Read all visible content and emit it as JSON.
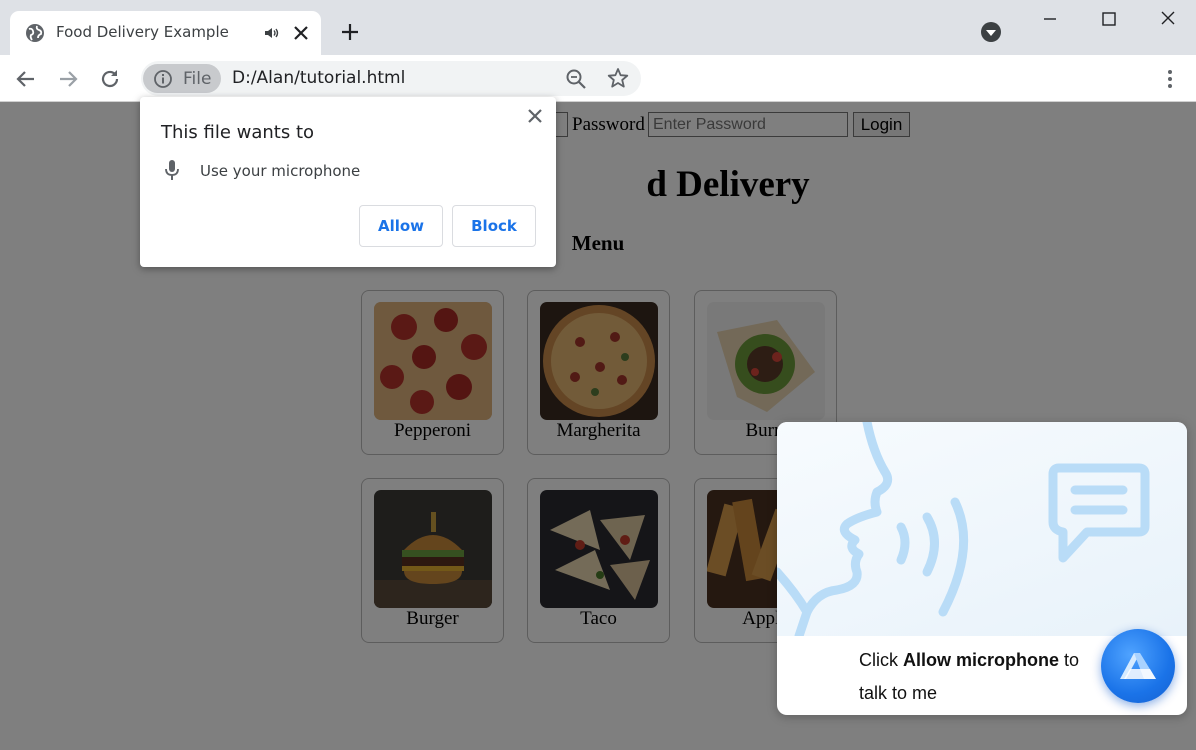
{
  "browser": {
    "tab_title": "Food Delivery Example",
    "site_chip_label": "File",
    "url": "D:/Alan/tutorial.html"
  },
  "page": {
    "password_label": "Password",
    "password_placeholder": "Enter Password",
    "login_label": "Login",
    "site_title": "d Delivery",
    "menu_heading": "Menu",
    "items": [
      {
        "label": "Pepperoni"
      },
      {
        "label": "Margherita"
      },
      {
        "label": "Burri"
      },
      {
        "label": "Burger"
      },
      {
        "label": "Taco"
      },
      {
        "label": "Apple"
      }
    ]
  },
  "permission_popup": {
    "title": "This file wants to",
    "permission": "Use your microphone",
    "allow_label": "Allow",
    "block_label": "Block"
  },
  "assistant": {
    "text_before": "Click ",
    "text_bold": "Allow microphone",
    "text_after": " to talk to me"
  },
  "colors": {
    "accent_blue": "#1a73e8",
    "assistant_art": "#b9dcf7"
  }
}
